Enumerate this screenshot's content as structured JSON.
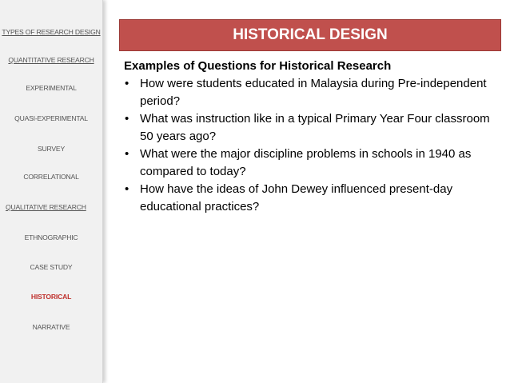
{
  "sidebar": {
    "items": [
      {
        "label": "TYPES OF RESEARCH DESIGN"
      },
      {
        "label": "QUANTITATIVE RESEARCH"
      },
      {
        "label": "EXPERIMENTAL"
      },
      {
        "label": "QUASI-EXPERIMENTAL"
      },
      {
        "label": "SURVEY"
      },
      {
        "label": "CORRELATIONAL"
      },
      {
        "label": "QUALITATIVE RESEARCH"
      },
      {
        "label": "ETHNOGRAPHIC"
      },
      {
        "label": "CASE STUDY"
      },
      {
        "label": "HISTORICAL"
      },
      {
        "label": "NARRATIVE"
      }
    ],
    "active_color": "#c0332f"
  },
  "slide": {
    "title": "HISTORICAL DESIGN",
    "title_bg": "#c0504d",
    "heading": "Examples of Questions for Historical Research",
    "bullet_glyph": "•",
    "bullets": [
      "How were students educated in Malaysia during Pre-independent period?",
      "What was instruction like in a typical Primary Year Four classroom 50 years ago?",
      "What were the major discipline problems in schools in 1940 as compared to today?",
      "How have the ideas of John Dewey influenced present-day educational practices?"
    ]
  }
}
